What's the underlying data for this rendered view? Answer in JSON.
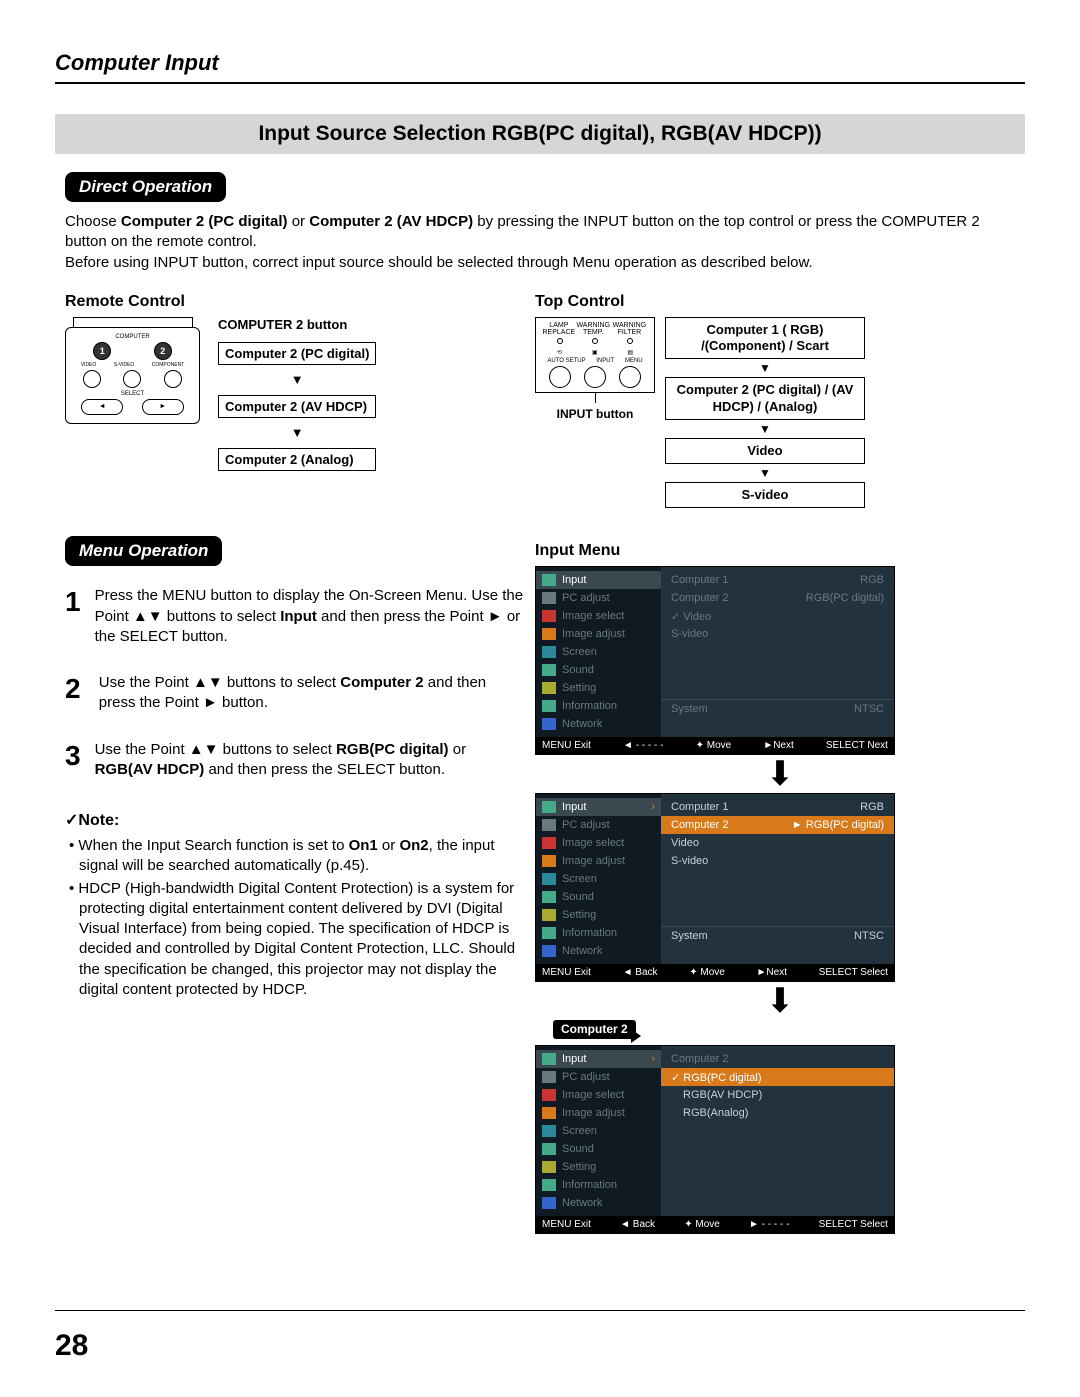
{
  "header": {
    "section": "Computer Input"
  },
  "banner": "Input Source Selection RGB(PC digital), RGB(AV HDCP))",
  "directOp": {
    "pill": "Direct Operation",
    "para1a": "Choose ",
    "bold1": "Computer 2 (PC digital)",
    "mid1": " or ",
    "bold2": "Computer 2 (AV HDCP)",
    "para1b": " by pressing the INPUT button on the top control or press the COMPUTER 2 button on the remote control.",
    "para2": "Before using INPUT button, correct input source should be selected through Menu operation as described below."
  },
  "remote": {
    "head": "Remote Control",
    "comp2btn": "COMPUTER 2 button",
    "labels": {
      "computer": "COMPUTER",
      "video": "VIDEO",
      "svideo": "S-VIDEO",
      "component": "COMPONENT",
      "select": "SELECT"
    },
    "opts": [
      "Computer 2 (PC digital)",
      "Computer 2 (AV HDCP)",
      "Computer 2 (Analog)"
    ]
  },
  "top": {
    "head": "Top Control",
    "panel": {
      "lamp": "LAMP REPLACE",
      "warnT": "WARNING TEMP.",
      "warnF": "WARNING FILTER",
      "auto": "AUTO SETUP",
      "input": "INPUT",
      "menu": "MENU"
    },
    "inputBtn": "INPUT button",
    "flow": [
      "Computer 1 ( RGB) /(Component) / Scart",
      "Computer 2 (PC digital) / (AV HDCP) / (Analog)",
      "Video",
      "S-video"
    ]
  },
  "menuOp": {
    "pill": "Menu Operation"
  },
  "steps": [
    {
      "n": "1",
      "t1": "Press the MENU button to display the On-Screen Menu. Use the Point ▲▼ buttons to select ",
      "b": "Input",
      "t2": " and then press the Point ► or the SELECT button."
    },
    {
      "n": "2",
      "t1": "Use the Point ▲▼ buttons to select ",
      "b": "Computer 2",
      "t2": " and then press the Point ► button."
    },
    {
      "n": "3",
      "t1": "Use the Point ▲▼ buttons to select ",
      "b": "RGB(PC digital)",
      "t2": "",
      "t3": " or ",
      "b2": "RGB(AV HDCP)",
      "t4": " and then press the SELECT button."
    }
  ],
  "inputMenuHead": "Input Menu",
  "noteHead": "✓Note:",
  "notes": [
    {
      "pre": "When the Input Search function is set to ",
      "b1": "On1",
      "mid": " or ",
      "b2": "On2",
      "post": ", the input signal will be searched automatically (p.45)."
    },
    {
      "full": "HDCP (High-bandwidth Digital Content Protection) is a system for protecting digital entertainment content delivered by DVI (Digital Visual Interface) from being copied. The specification of HDCP is decided and controlled by Digital Content Protection, LLC. Should the specification be changed, this projector may not display the digital content protected by HDCP."
    }
  ],
  "menuPanel": {
    "leftItems": [
      "Input",
      "PC adjust",
      "Image select",
      "Image adjust",
      "Screen",
      "Sound",
      "Setting",
      "Information",
      "Network"
    ],
    "screen1Right": [
      {
        "l": "Computer 1",
        "r": "RGB"
      },
      {
        "l": "Computer 2",
        "r": "RGB(PC digital)"
      },
      {
        "l": "Video",
        "r": "",
        "chk": true
      },
      {
        "l": "S-video",
        "r": ""
      }
    ],
    "screen1Sys": {
      "l": "System",
      "r": "NTSC"
    },
    "screen2Right": [
      {
        "l": "Computer 1",
        "r": "RGB"
      },
      {
        "l": "Computer 2",
        "r": "RGB(PC digital)",
        "sel": true
      },
      {
        "l": "Video",
        "r": ""
      },
      {
        "l": "S-video",
        "r": ""
      }
    ],
    "screen2Sys": {
      "l": "System",
      "r": "NTSC"
    },
    "compChip": "Computer 2",
    "screen3Head": "Computer 2",
    "screen3Right": [
      {
        "l": "RGB(PC digital)",
        "sel": true,
        "chk": true
      },
      {
        "l": "RGB(AV HDCP)"
      },
      {
        "l": "RGB(Analog)"
      }
    ],
    "foot1": [
      "MENU Exit",
      "◄ - - - - -",
      "✦ Move",
      "►Next",
      "SELECT Next"
    ],
    "foot2": [
      "MENU Exit",
      "◄ Back",
      "✦ Move",
      "►Next",
      "SELECT Select"
    ],
    "foot3": [
      "MENU Exit",
      "◄ Back",
      "✦ Move",
      "► - - - - -",
      "SELECT Select"
    ]
  },
  "pageNum": "28"
}
